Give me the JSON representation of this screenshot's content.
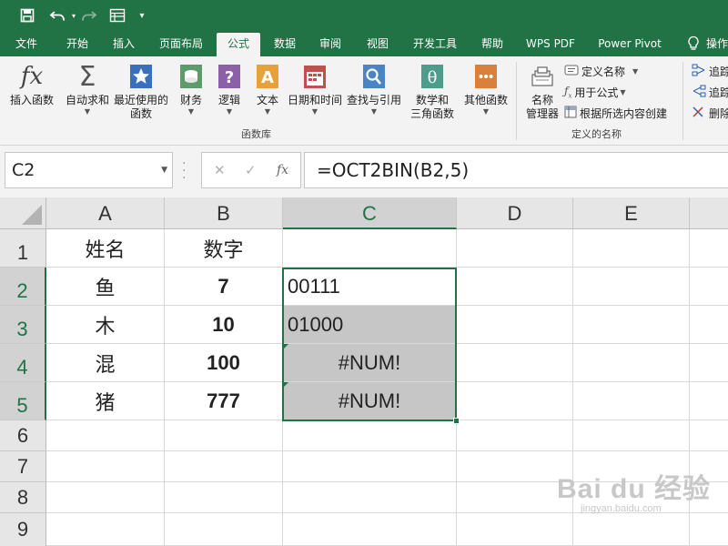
{
  "quick_access": {
    "icons": [
      "save-icon",
      "undo-icon",
      "redo-icon",
      "form-icon",
      "customize-icon"
    ]
  },
  "tabs": [
    {
      "label": "文件"
    },
    {
      "label": "开始"
    },
    {
      "label": "插入"
    },
    {
      "label": "页面布局"
    },
    {
      "label": "公式",
      "active": true
    },
    {
      "label": "数据"
    },
    {
      "label": "审阅"
    },
    {
      "label": "视图"
    },
    {
      "label": "开发工具"
    },
    {
      "label": "帮助"
    },
    {
      "label": "WPS PDF"
    },
    {
      "label": "Power Pivot"
    },
    {
      "label": "操作"
    }
  ],
  "ribbon": {
    "function_library": {
      "group_label": "函数库",
      "buttons": [
        {
          "line1": "插入函数",
          "line2": "",
          "icon": "fx-icon"
        },
        {
          "line1": "自动求和",
          "line2": "",
          "icon": "sum-icon"
        },
        {
          "line1": "最近使用的",
          "line2": "函数",
          "icon": "star-icon"
        },
        {
          "line1": "财务",
          "line2": "",
          "icon": "finance-icon"
        },
        {
          "line1": "逻辑",
          "line2": "",
          "icon": "question-icon"
        },
        {
          "line1": "文本",
          "line2": "",
          "icon": "text-a-icon"
        },
        {
          "line1": "日期和时间",
          "line2": "",
          "icon": "calendar-icon"
        },
        {
          "line1": "查找与引用",
          "line2": "",
          "icon": "magnifier-icon"
        },
        {
          "line1": "数学和",
          "line2": "三角函数",
          "icon": "theta-icon"
        },
        {
          "line1": "其他函数",
          "line2": "",
          "icon": "more-functions-icon"
        }
      ]
    },
    "defined_names": {
      "group_label": "定义的名称",
      "name_manager_line1": "名称",
      "name_manager_line2": "管理器",
      "define_name": "定义名称",
      "use_in_formula": "用于公式",
      "create_from_selection": "根据所选内容创建"
    },
    "auditing": {
      "trace_precedents": "追踪",
      "trace_dependents": "追踪",
      "remove_arrows": "删除"
    }
  },
  "formula_bar": {
    "name_box": "C2",
    "formula": "=OCT2BIN(B2,5)",
    "fx_label": "fx"
  },
  "sheet": {
    "columns": [
      "A",
      "B",
      "C",
      "D",
      "E"
    ],
    "rows": [
      "1",
      "2",
      "3",
      "4",
      "5",
      "6",
      "7",
      "8",
      "9"
    ],
    "selected_column": "C",
    "selected_range": "C2:C5",
    "cells": {
      "A1": "姓名",
      "B1": "数字",
      "A2": "鱼",
      "B2": "7",
      "C2": "00111",
      "A3": "木",
      "B3": "10",
      "C3": "01000",
      "A4": "混",
      "B4": "100",
      "C4": "#NUM!",
      "A5": "猪",
      "B5": "777",
      "C5": "#NUM!"
    }
  },
  "watermark": {
    "line1": "Bai du 经验",
    "line2": "jingyan.baidu.com"
  },
  "colors": {
    "excel_green": "#217346",
    "ribbon_bg": "#f3f3f3",
    "header_bg": "#e6e6e6",
    "selection_fill": "#c6c6c6"
  }
}
